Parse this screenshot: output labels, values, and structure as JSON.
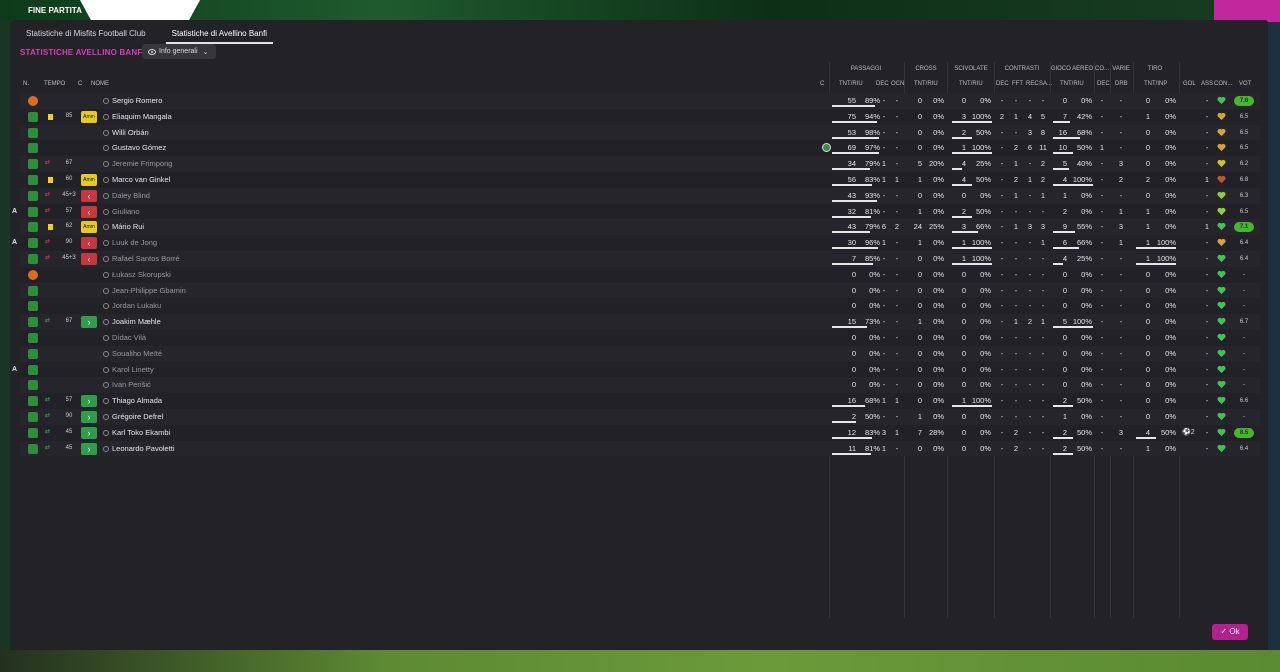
{
  "match_bar": {
    "event_label": "FINE PARTITA"
  },
  "tabs": [
    {
      "label": "Statistiche di Misfits Football Club"
    },
    {
      "label": "Statistiche di Avellino Banfi"
    }
  ],
  "team_title": "STATISTICHE AVELLINO BANFI",
  "view_dropdown": {
    "label": "Info generali"
  },
  "columns": {
    "n": "N.",
    "tempo": "TEMPO",
    "c": "C",
    "nome": "NOME",
    "c2": "C",
    "groups": {
      "passaggi": "PASSAGGI",
      "cross": "CROSS",
      "scivolate": "SCIVOLATE",
      "contrasti": "CONTRASTI",
      "gioco_aereo": "GIOCO AEREO",
      "co": "CO...",
      "varie": "VARIE",
      "tiro": "TIRO"
    },
    "sub": {
      "pass_tnt": "TNT/RIU",
      "pass_dec": "DEC",
      "pass_ocn": "OCN",
      "cross_tnt": "TNT/RIU",
      "sciv_tnt": "TNT/RIU",
      "contr_dec": "DEC",
      "contr_fft": "FFT",
      "contr_rec": "REC",
      "contr_sa": "SA...",
      "aereo_tnt": "TNT/RIU",
      "co_dec": "DEC",
      "varie_drb": "DRB",
      "tiro_tnt": "TNT/INP",
      "gol": "GOL",
      "ass": "ASS",
      "con": "CON...",
      "vot": "VOT"
    }
  },
  "players": [
    {
      "name": "Sergio Romero",
      "dim": false,
      "a": "",
      "shirt": "orange",
      "sub": "",
      "min": "",
      "card": "",
      "tag": "",
      "c": false,
      "p_t": "55",
      "p_pct": "89%",
      "p_bar": 0.89,
      "p_dec": "-",
      "p_ocn": "-",
      "cr_t": "0",
      "cr_pct": "0%",
      "sc_t": "0",
      "sc_pct": "0%",
      "sc_bar": 0,
      "ct_dec": "-",
      "ct_fft": "-",
      "ct_rec": "-",
      "ct_sa": "-",
      "ae_t": "0",
      "ae_pct": "0%",
      "ae_bar": 0,
      "co_dec": "-",
      "va_drb": "-",
      "ti_t": "0",
      "ti_pct": "0%",
      "ti_bar": 0,
      "gol": "",
      "ass": "-",
      "heart": "#41c15a",
      "vot": "7.6",
      "vot_green": true
    },
    {
      "name": "Eliaquim Mangala",
      "dim": false,
      "a": "",
      "shirt": "green",
      "sub": "",
      "min": "85",
      "card": "yellow",
      "tag": "Amm",
      "c": false,
      "p_t": "75",
      "p_pct": "94%",
      "p_bar": 0.94,
      "p_dec": "-",
      "p_ocn": "-",
      "cr_t": "0",
      "cr_pct": "0%",
      "sc_t": "3",
      "sc_pct": "100%",
      "sc_bar": 1,
      "ct_dec": "2",
      "ct_fft": "1",
      "ct_rec": "4",
      "ct_sa": "5",
      "ae_t": "7",
      "ae_pct": "42%",
      "ae_bar": 0.42,
      "co_dec": "-",
      "va_drb": "-",
      "ti_t": "1",
      "ti_pct": "0%",
      "ti_bar": 0,
      "gol": "",
      "ass": "-",
      "heart": "#d4a43a",
      "vot": "6.5",
      "vot_green": false
    },
    {
      "name": "Willi Orbán",
      "dim": false,
      "a": "",
      "shirt": "green",
      "sub": "",
      "min": "",
      "card": "",
      "tag": "",
      "c": false,
      "p_t": "53",
      "p_pct": "98%",
      "p_bar": 0.98,
      "p_dec": "-",
      "p_ocn": "-",
      "cr_t": "0",
      "cr_pct": "0%",
      "sc_t": "2",
      "sc_pct": "50%",
      "sc_bar": 0.5,
      "ct_dec": "-",
      "ct_fft": "-",
      "ct_rec": "3",
      "ct_sa": "8",
      "ae_t": "16",
      "ae_pct": "68%",
      "ae_bar": 0.68,
      "co_dec": "-",
      "va_drb": "-",
      "ti_t": "0",
      "ti_pct": "0%",
      "ti_bar": 0,
      "gol": "",
      "ass": "-",
      "heart": "#d4a43a",
      "vot": "6.5",
      "vot_green": false
    },
    {
      "name": "Gustavo Gómez",
      "dim": false,
      "a": "",
      "shirt": "green",
      "sub": "",
      "min": "",
      "card": "",
      "tag": "",
      "c": true,
      "p_t": "69",
      "p_pct": "97%",
      "p_bar": 0.97,
      "p_dec": "-",
      "p_ocn": "-",
      "cr_t": "0",
      "cr_pct": "0%",
      "sc_t": "1",
      "sc_pct": "100%",
      "sc_bar": 1,
      "ct_dec": "-",
      "ct_fft": "2",
      "ct_rec": "6",
      "ct_sa": "11",
      "ae_t": "10",
      "ae_pct": "50%",
      "ae_bar": 0.5,
      "co_dec": "1",
      "va_drb": "-",
      "ti_t": "0",
      "ti_pct": "0%",
      "ti_bar": 0,
      "gol": "",
      "ass": "-",
      "heart": "#d4a43a",
      "vot": "6.5",
      "vot_green": false
    },
    {
      "name": "Jeremie Frimpong",
      "dim": true,
      "a": "",
      "shirt": "green",
      "sub": "out",
      "min": "67",
      "card": "",
      "tag": "",
      "c": false,
      "p_t": "34",
      "p_pct": "79%",
      "p_bar": 0.79,
      "p_dec": "1",
      "p_ocn": "-",
      "cr_t": "5",
      "cr_pct": "20%",
      "sc_t": "4",
      "sc_pct": "25%",
      "sc_bar": 0.25,
      "ct_dec": "-",
      "ct_fft": "1",
      "ct_rec": "-",
      "ct_sa": "2",
      "ae_t": "5",
      "ae_pct": "40%",
      "ae_bar": 0.4,
      "co_dec": "-",
      "va_drb": "3",
      "ti_t": "0",
      "ti_pct": "0%",
      "ti_bar": 0,
      "gol": "",
      "ass": "-",
      "heart": "#c9c12a",
      "vot": "6.2",
      "vot_green": false
    },
    {
      "name": "Marco van Ginkel",
      "dim": false,
      "a": "",
      "shirt": "green",
      "sub": "",
      "min": "60",
      "card": "yellow",
      "tag": "Amm",
      "c": false,
      "p_t": "56",
      "p_pct": "83%",
      "p_bar": 0.83,
      "p_dec": "1",
      "p_ocn": "1",
      "cr_t": "1",
      "cr_pct": "0%",
      "sc_t": "4",
      "sc_pct": "50%",
      "sc_bar": 0.5,
      "ct_dec": "-",
      "ct_fft": "2",
      "ct_rec": "1",
      "ct_sa": "2",
      "ae_t": "4",
      "ae_pct": "100%",
      "ae_bar": 1,
      "co_dec": "-",
      "va_drb": "2",
      "ti_t": "2",
      "ti_pct": "0%",
      "ti_bar": 0,
      "gol": "",
      "ass": "1",
      "heart": "#c0572a",
      "vot": "6.8",
      "vot_green": false
    },
    {
      "name": "Daley Blind",
      "dim": true,
      "a": "",
      "shirt": "green",
      "sub": "out",
      "min": "45+3",
      "card": "",
      "tag": "out",
      "c": false,
      "p_t": "43",
      "p_pct": "93%",
      "p_bar": 0.93,
      "p_dec": "-",
      "p_ocn": "-",
      "cr_t": "0",
      "cr_pct": "0%",
      "sc_t": "0",
      "sc_pct": "0%",
      "sc_bar": 0,
      "ct_dec": "-",
      "ct_fft": "1",
      "ct_rec": "-",
      "ct_sa": "1",
      "ae_t": "1",
      "ae_pct": "0%",
      "ae_bar": 0,
      "co_dec": "-",
      "va_drb": "-",
      "ti_t": "0",
      "ti_pct": "0%",
      "ti_bar": 0,
      "gol": "",
      "ass": "-",
      "heart": "#8bcf3a",
      "vot": "6.3",
      "vot_green": false
    },
    {
      "name": "Giuliano",
      "dim": true,
      "a": "A",
      "shirt": "green",
      "sub": "out",
      "min": "57",
      "card": "",
      "tag": "out",
      "c": false,
      "p_t": "32",
      "p_pct": "81%",
      "p_bar": 0.81,
      "p_dec": "-",
      "p_ocn": "-",
      "cr_t": "1",
      "cr_pct": "0%",
      "sc_t": "2",
      "sc_pct": "50%",
      "sc_bar": 0.5,
      "ct_dec": "-",
      "ct_fft": "-",
      "ct_rec": "-",
      "ct_sa": "-",
      "ae_t": "2",
      "ae_pct": "0%",
      "ae_bar": 0,
      "co_dec": "-",
      "va_drb": "1",
      "ti_t": "1",
      "ti_pct": "0%",
      "ti_bar": 0,
      "gol": "",
      "ass": "-",
      "heart": "#8bcf3a",
      "vot": "6.5",
      "vot_green": false
    },
    {
      "name": "Mário Rui",
      "dim": false,
      "a": "",
      "shirt": "green",
      "sub": "",
      "min": "62",
      "card": "yellow",
      "tag": "Amm",
      "c": false,
      "p_t": "43",
      "p_pct": "79%",
      "p_bar": 0.79,
      "p_dec": "6",
      "p_ocn": "2",
      "cr_t": "24",
      "cr_pct": "25%",
      "sc_t": "3",
      "sc_pct": "66%",
      "sc_bar": 0.66,
      "ct_dec": "-",
      "ct_fft": "1",
      "ct_rec": "3",
      "ct_sa": "3",
      "ae_t": "9",
      "ae_pct": "55%",
      "ae_bar": 0.55,
      "co_dec": "-",
      "va_drb": "3",
      "ti_t": "1",
      "ti_pct": "0%",
      "ti_bar": 0,
      "gol": "",
      "ass": "1",
      "heart": "#41c15a",
      "vot": "7.1",
      "vot_green": true
    },
    {
      "name": "Luuk de Jong",
      "dim": true,
      "a": "A",
      "shirt": "green",
      "sub": "out",
      "min": "90",
      "card": "",
      "tag": "out",
      "c": false,
      "p_t": "30",
      "p_pct": "96%",
      "p_bar": 0.96,
      "p_dec": "1",
      "p_ocn": "-",
      "cr_t": "1",
      "cr_pct": "0%",
      "sc_t": "1",
      "sc_pct": "100%",
      "sc_bar": 1,
      "ct_dec": "-",
      "ct_fft": "-",
      "ct_rec": "-",
      "ct_sa": "1",
      "ae_t": "6",
      "ae_pct": "66%",
      "ae_bar": 0.66,
      "co_dec": "-",
      "va_drb": "1",
      "ti_t": "1",
      "ti_pct": "100%",
      "ti_bar": 1,
      "gol": "",
      "ass": "-",
      "heart": "#d4a43a",
      "vot": "6.4",
      "vot_green": false
    },
    {
      "name": "Rafael Santos Borré",
      "dim": true,
      "a": "",
      "shirt": "green",
      "sub": "out",
      "min": "45+3",
      "card": "",
      "tag": "out",
      "c": false,
      "p_t": "7",
      "p_pct": "85%",
      "p_bar": 0.85,
      "p_dec": "-",
      "p_ocn": "-",
      "cr_t": "0",
      "cr_pct": "0%",
      "sc_t": "1",
      "sc_pct": "100%",
      "sc_bar": 1,
      "ct_dec": "-",
      "ct_fft": "-",
      "ct_rec": "-",
      "ct_sa": "-",
      "ae_t": "4",
      "ae_pct": "25%",
      "ae_bar": 0.25,
      "co_dec": "-",
      "va_drb": "-",
      "ti_t": "1",
      "ti_pct": "100%",
      "ti_bar": 1,
      "gol": "",
      "ass": "-",
      "heart": "#41c15a",
      "vot": "6.4",
      "vot_green": false
    },
    {
      "name": "Łukasz Skorupski",
      "dim": true,
      "a": "",
      "shirt": "orange",
      "sub": "",
      "min": "",
      "card": "",
      "tag": "",
      "c": false,
      "p_t": "0",
      "p_pct": "0%",
      "p_bar": 0,
      "p_dec": "-",
      "p_ocn": "-",
      "cr_t": "0",
      "cr_pct": "0%",
      "sc_t": "0",
      "sc_pct": "0%",
      "sc_bar": 0,
      "ct_dec": "-",
      "ct_fft": "-",
      "ct_rec": "-",
      "ct_sa": "-",
      "ae_t": "0",
      "ae_pct": "0%",
      "ae_bar": 0,
      "co_dec": "-",
      "va_drb": "-",
      "ti_t": "0",
      "ti_pct": "0%",
      "ti_bar": 0,
      "gol": "",
      "ass": "-",
      "heart": "#41c15a",
      "vot": "-",
      "vot_green": false
    },
    {
      "name": "Jean-Philippe Gbamin",
      "dim": true,
      "a": "",
      "shirt": "green",
      "sub": "",
      "min": "",
      "card": "",
      "tag": "",
      "c": false,
      "p_t": "0",
      "p_pct": "0%",
      "p_bar": 0,
      "p_dec": "-",
      "p_ocn": "-",
      "cr_t": "0",
      "cr_pct": "0%",
      "sc_t": "0",
      "sc_pct": "0%",
      "sc_bar": 0,
      "ct_dec": "-",
      "ct_fft": "-",
      "ct_rec": "-",
      "ct_sa": "-",
      "ae_t": "0",
      "ae_pct": "0%",
      "ae_bar": 0,
      "co_dec": "-",
      "va_drb": "-",
      "ti_t": "0",
      "ti_pct": "0%",
      "ti_bar": 0,
      "gol": "",
      "ass": "-",
      "heart": "#41c15a",
      "vot": "-",
      "vot_green": false
    },
    {
      "name": "Jordan Lukaku",
      "dim": true,
      "a": "",
      "shirt": "green",
      "sub": "",
      "min": "",
      "card": "",
      "tag": "",
      "c": false,
      "p_t": "0",
      "p_pct": "0%",
      "p_bar": 0,
      "p_dec": "-",
      "p_ocn": "-",
      "cr_t": "0",
      "cr_pct": "0%",
      "sc_t": "0",
      "sc_pct": "0%",
      "sc_bar": 0,
      "ct_dec": "-",
      "ct_fft": "-",
      "ct_rec": "-",
      "ct_sa": "-",
      "ae_t": "0",
      "ae_pct": "0%",
      "ae_bar": 0,
      "co_dec": "-",
      "va_drb": "-",
      "ti_t": "0",
      "ti_pct": "0%",
      "ti_bar": 0,
      "gol": "",
      "ass": "-",
      "heart": "#41c15a",
      "vot": "-",
      "vot_green": false
    },
    {
      "name": "Joakim Mæhle",
      "dim": false,
      "a": "",
      "shirt": "green",
      "sub": "in",
      "min": "67",
      "card": "",
      "tag": "in",
      "c": false,
      "p_t": "15",
      "p_pct": "73%",
      "p_bar": 0.73,
      "p_dec": "-",
      "p_ocn": "-",
      "cr_t": "1",
      "cr_pct": "0%",
      "sc_t": "0",
      "sc_pct": "0%",
      "sc_bar": 0,
      "ct_dec": "-",
      "ct_fft": "1",
      "ct_rec": "2",
      "ct_sa": "1",
      "ae_t": "5",
      "ae_pct": "100%",
      "ae_bar": 1,
      "co_dec": "-",
      "va_drb": "-",
      "ti_t": "0",
      "ti_pct": "0%",
      "ti_bar": 0,
      "gol": "",
      "ass": "-",
      "heart": "#41c15a",
      "vot": "6.7",
      "vot_green": false
    },
    {
      "name": "Dídac Vilà",
      "dim": true,
      "a": "",
      "shirt": "green",
      "sub": "",
      "min": "",
      "card": "",
      "tag": "",
      "c": false,
      "p_t": "0",
      "p_pct": "0%",
      "p_bar": 0,
      "p_dec": "-",
      "p_ocn": "-",
      "cr_t": "0",
      "cr_pct": "0%",
      "sc_t": "0",
      "sc_pct": "0%",
      "sc_bar": 0,
      "ct_dec": "-",
      "ct_fft": "-",
      "ct_rec": "-",
      "ct_sa": "-",
      "ae_t": "0",
      "ae_pct": "0%",
      "ae_bar": 0,
      "co_dec": "-",
      "va_drb": "-",
      "ti_t": "0",
      "ti_pct": "0%",
      "ti_bar": 0,
      "gol": "",
      "ass": "-",
      "heart": "#41c15a",
      "vot": "-",
      "vot_green": false
    },
    {
      "name": "Soualiho Meïté",
      "dim": true,
      "a": "",
      "shirt": "green",
      "sub": "",
      "min": "",
      "card": "",
      "tag": "",
      "c": false,
      "p_t": "0",
      "p_pct": "0%",
      "p_bar": 0,
      "p_dec": "-",
      "p_ocn": "-",
      "cr_t": "0",
      "cr_pct": "0%",
      "sc_t": "0",
      "sc_pct": "0%",
      "sc_bar": 0,
      "ct_dec": "-",
      "ct_fft": "-",
      "ct_rec": "-",
      "ct_sa": "-",
      "ae_t": "0",
      "ae_pct": "0%",
      "ae_bar": 0,
      "co_dec": "-",
      "va_drb": "-",
      "ti_t": "0",
      "ti_pct": "0%",
      "ti_bar": 0,
      "gol": "",
      "ass": "-",
      "heart": "#41c15a",
      "vot": "-",
      "vot_green": false
    },
    {
      "name": "Karol Linetty",
      "dim": true,
      "a": "A",
      "shirt": "green",
      "sub": "",
      "min": "",
      "card": "",
      "tag": "",
      "c": false,
      "p_t": "0",
      "p_pct": "0%",
      "p_bar": 0,
      "p_dec": "-",
      "p_ocn": "-",
      "cr_t": "0",
      "cr_pct": "0%",
      "sc_t": "0",
      "sc_pct": "0%",
      "sc_bar": 0,
      "ct_dec": "-",
      "ct_fft": "-",
      "ct_rec": "-",
      "ct_sa": "-",
      "ae_t": "0",
      "ae_pct": "0%",
      "ae_bar": 0,
      "co_dec": "-",
      "va_drb": "-",
      "ti_t": "0",
      "ti_pct": "0%",
      "ti_bar": 0,
      "gol": "",
      "ass": "-",
      "heart": "#41c15a",
      "vot": "-",
      "vot_green": false
    },
    {
      "name": "Ivan Perišić",
      "dim": true,
      "a": "",
      "shirt": "green",
      "sub": "",
      "min": "",
      "card": "",
      "tag": "",
      "c": false,
      "p_t": "0",
      "p_pct": "0%",
      "p_bar": 0,
      "p_dec": "-",
      "p_ocn": "-",
      "cr_t": "0",
      "cr_pct": "0%",
      "sc_t": "0",
      "sc_pct": "0%",
      "sc_bar": 0,
      "ct_dec": "-",
      "ct_fft": "-",
      "ct_rec": "-",
      "ct_sa": "-",
      "ae_t": "0",
      "ae_pct": "0%",
      "ae_bar": 0,
      "co_dec": "-",
      "va_drb": "-",
      "ti_t": "0",
      "ti_pct": "0%",
      "ti_bar": 0,
      "gol": "",
      "ass": "-",
      "heart": "#41c15a",
      "vot": "-",
      "vot_green": false
    },
    {
      "name": "Thiago Almada",
      "dim": false,
      "a": "",
      "shirt": "green",
      "sub": "in",
      "min": "57",
      "card": "",
      "tag": "in",
      "c": false,
      "p_t": "16",
      "p_pct": "68%",
      "p_bar": 0.68,
      "p_dec": "1",
      "p_ocn": "1",
      "cr_t": "0",
      "cr_pct": "0%",
      "sc_t": "1",
      "sc_pct": "100%",
      "sc_bar": 1,
      "ct_dec": "-",
      "ct_fft": "-",
      "ct_rec": "-",
      "ct_sa": "-",
      "ae_t": "2",
      "ae_pct": "50%",
      "ae_bar": 0.5,
      "co_dec": "-",
      "va_drb": "-",
      "ti_t": "0",
      "ti_pct": "0%",
      "ti_bar": 0,
      "gol": "",
      "ass": "-",
      "heart": "#41c15a",
      "vot": "6.6",
      "vot_green": false
    },
    {
      "name": "Grégoire Defrel",
      "dim": false,
      "a": "",
      "shirt": "green",
      "sub": "in",
      "min": "90",
      "card": "",
      "tag": "in",
      "c": false,
      "p_t": "2",
      "p_pct": "50%",
      "p_bar": 0.5,
      "p_dec": "-",
      "p_ocn": "-",
      "cr_t": "1",
      "cr_pct": "0%",
      "sc_t": "0",
      "sc_pct": "0%",
      "sc_bar": 0,
      "ct_dec": "-",
      "ct_fft": "-",
      "ct_rec": "-",
      "ct_sa": "-",
      "ae_t": "1",
      "ae_pct": "0%",
      "ae_bar": 0,
      "co_dec": "-",
      "va_drb": "-",
      "ti_t": "0",
      "ti_pct": "0%",
      "ti_bar": 0,
      "gol": "",
      "ass": "-",
      "heart": "#41c15a",
      "vot": "-",
      "vot_green": false
    },
    {
      "name": "Karl Toko Ekambi",
      "dim": false,
      "a": "",
      "shirt": "green",
      "sub": "in",
      "min": "45",
      "card": "",
      "tag": "in",
      "c": false,
      "p_t": "12",
      "p_pct": "83%",
      "p_bar": 0.83,
      "p_dec": "3",
      "p_ocn": "1",
      "cr_t": "7",
      "cr_pct": "28%",
      "sc_t": "0",
      "sc_pct": "0%",
      "sc_bar": 0,
      "ct_dec": "-",
      "ct_fft": "2",
      "ct_rec": "-",
      "ct_sa": "-",
      "ae_t": "2",
      "ae_pct": "50%",
      "ae_bar": 0.5,
      "co_dec": "-",
      "va_drb": "3",
      "ti_t": "4",
      "ti_pct": "50%",
      "ti_bar": 0.5,
      "gol": "2",
      "ass": "-",
      "heart": "#41c15a",
      "vot": "8.5",
      "vot_green": true
    },
    {
      "name": "Leonardo Pavoletti",
      "dim": false,
      "a": "",
      "shirt": "green",
      "sub": "in",
      "min": "45",
      "card": "",
      "tag": "in",
      "c": false,
      "p_t": "11",
      "p_pct": "81%",
      "p_bar": 0.81,
      "p_dec": "1",
      "p_ocn": "-",
      "cr_t": "0",
      "cr_pct": "0%",
      "sc_t": "0",
      "sc_pct": "0%",
      "sc_bar": 0,
      "ct_dec": "-",
      "ct_fft": "2",
      "ct_rec": "-",
      "ct_sa": "-",
      "ae_t": "2",
      "ae_pct": "50%",
      "ae_bar": 0.5,
      "co_dec": "-",
      "va_drb": "-",
      "ti_t": "1",
      "ti_pct": "0%",
      "ti_bar": 0,
      "gol": "",
      "ass": "-",
      "heart": "#41c15a",
      "vot": "6.4",
      "vot_green": false
    }
  ],
  "ok_button": {
    "label": "Ok"
  }
}
